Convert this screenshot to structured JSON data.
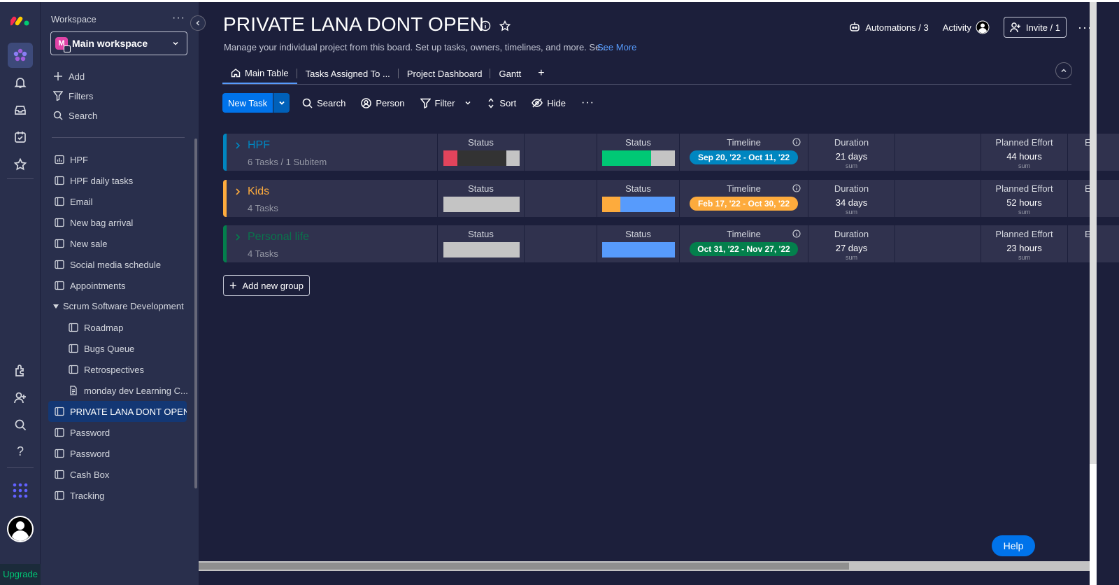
{
  "rail": {
    "icons": [
      "monday-logo",
      "work-management-icon",
      "bell-icon",
      "inbox-icon",
      "my-work-icon",
      "star-icon",
      "integrations-icon",
      "invite-members-icon",
      "search-icon",
      "help-icon",
      "apps-grid-icon",
      "user-avatar-icon"
    ],
    "upgrade": "Upgrade"
  },
  "sidebar": {
    "workspace_label": "Workspace",
    "workspace_name": "Main workspace",
    "workspace_initial": "M",
    "actions": [
      "Add",
      "Filters",
      "Search"
    ],
    "boards": [
      {
        "label": "HPF"
      },
      {
        "label": "HPF daily tasks"
      },
      {
        "label": "Email"
      },
      {
        "label": "New bag arrival"
      },
      {
        "label": "New sale"
      },
      {
        "label": "Social media schedule"
      },
      {
        "label": "Appointments"
      }
    ],
    "folder": "Scrum Software Development",
    "folder_items": [
      {
        "label": "Roadmap"
      },
      {
        "label": "Bugs Queue"
      },
      {
        "label": "Retrospectives"
      },
      {
        "label": "monday dev Learning C..."
      }
    ],
    "active_board": "PRIVATE LANA DONT OPEN",
    "boards_after": [
      {
        "label": "Password"
      },
      {
        "label": "Password"
      },
      {
        "label": "Cash Box"
      },
      {
        "label": "Tracking"
      }
    ]
  },
  "header": {
    "title": "PRIVATE LANA DONT OPEN",
    "description": "Manage your individual project from this board. Set up tasks, owners, timelines, and more. Se...",
    "see_more": "See More",
    "automations": "Automations / 3",
    "activity": "Activity",
    "invite": "Invite / 1"
  },
  "tabs": [
    "Main Table",
    "Tasks Assigned To ...",
    "Project Dashboard",
    "Gantt",
    "+"
  ],
  "toolbar": {
    "new_task": "New Task",
    "search": "Search",
    "person": "Person",
    "filter": "Filter",
    "sort": "Sort",
    "hide": "Hide"
  },
  "columns": {
    "status": "Status",
    "timeline": "Timeline",
    "duration": "Duration",
    "planned_effort": "Planned Effort",
    "sum": "sum",
    "cut": "E"
  },
  "groups": [
    {
      "name": "HPF",
      "subtitle": "6 Tasks / 1 Subitem",
      "color": "#0086c0",
      "status1": [
        {
          "color": "#e2445c",
          "pct": 18
        },
        {
          "color": "#333333",
          "pct": 65
        },
        {
          "color": "#c4c4c4",
          "pct": 17
        }
      ],
      "status2": [
        {
          "color": "#00c875",
          "pct": 67
        },
        {
          "color": "#c4c4c4",
          "pct": 33
        }
      ],
      "timeline": "Sep 20, '22 - Oct 11, '22",
      "timeline_color": "#0086c0",
      "duration": "21 days",
      "effort": "44 hours"
    },
    {
      "name": "Kids",
      "subtitle": "4 Tasks",
      "color": "#fdab3d",
      "status1": [
        {
          "color": "#c4c4c4",
          "pct": 100
        }
      ],
      "status2": [
        {
          "color": "#fdab3d",
          "pct": 25
        },
        {
          "color": "#579bfc",
          "pct": 75
        }
      ],
      "timeline": "Feb 17, '22 - Oct 30, '22",
      "timeline_color": "#fdab3d",
      "duration": "34 days",
      "effort": "52 hours"
    },
    {
      "name": "Personal life",
      "subtitle": "4 Tasks",
      "color": "#037f4c",
      "status1": [
        {
          "color": "#c4c4c4",
          "pct": 100
        }
      ],
      "status2": [
        {
          "color": "#579bfc",
          "pct": 100
        }
      ],
      "timeline": "Oct 31, '22 - Nov 27, '22",
      "timeline_color": "#037f4c",
      "duration": "27 days",
      "effort": "23 hours"
    }
  ],
  "add_group": "Add new group",
  "help": "Help"
}
